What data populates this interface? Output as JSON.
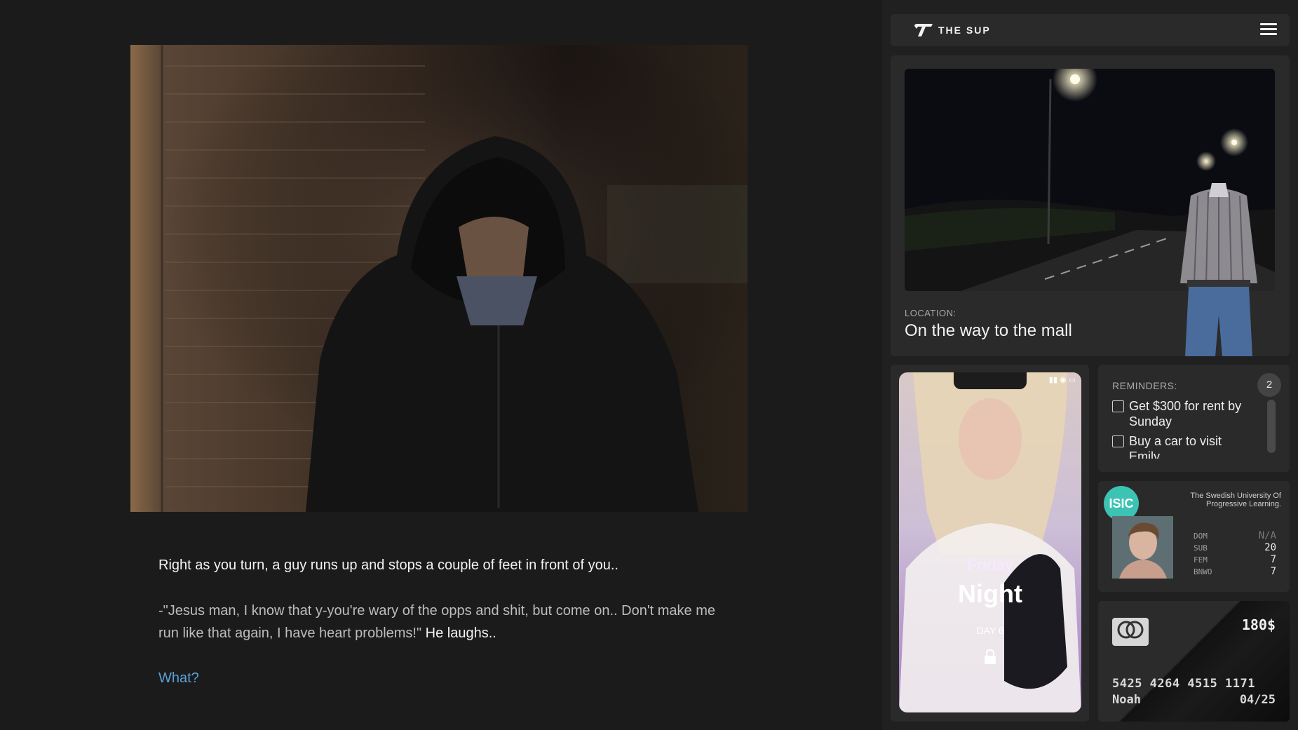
{
  "story": {
    "narration": "Right as you turn, a guy runs up and stops a couple of feet in front of you..",
    "dialogue": "-\"Jesus man, I know that y-you're wary of the opps and shit, but come on.. Don't make me run like that again, I have heart problems!\"",
    "dialogue_action": "He laughs..",
    "choice": "What?"
  },
  "header": {
    "brand": "THE SUP"
  },
  "location": {
    "label": "LOCATION:",
    "value": "On the way to the mall"
  },
  "phone": {
    "day": "Friday",
    "time_of_day": "Night",
    "day_counter": "DAY 6"
  },
  "reminders": {
    "title": "REMINDERS:",
    "count": "2",
    "items": [
      {
        "label": "Get $300 for rent by Sunday"
      },
      {
        "label": "Buy a car to visit Emily"
      }
    ]
  },
  "isic": {
    "logo": "ISIC",
    "university": "The Swedish University Of Progressive Learning.",
    "stats": [
      {
        "label": "DOM",
        "value": "N/A"
      },
      {
        "label": "SUB",
        "value": "20"
      },
      {
        "label": "FEM",
        "value": "7"
      },
      {
        "label": "BNWO",
        "value": "7"
      }
    ]
  },
  "bank_card": {
    "balance": "180$",
    "number": "5425 4264 4515 1171",
    "holder": "Noah",
    "expiry": "04/25",
    "brand_text": "mastercard"
  },
  "colors": {
    "background": "#1b1b1b",
    "panel": "#2a2a2a",
    "choice_link": "#5aa2d6",
    "isic_accent": "#3cc3b3"
  }
}
